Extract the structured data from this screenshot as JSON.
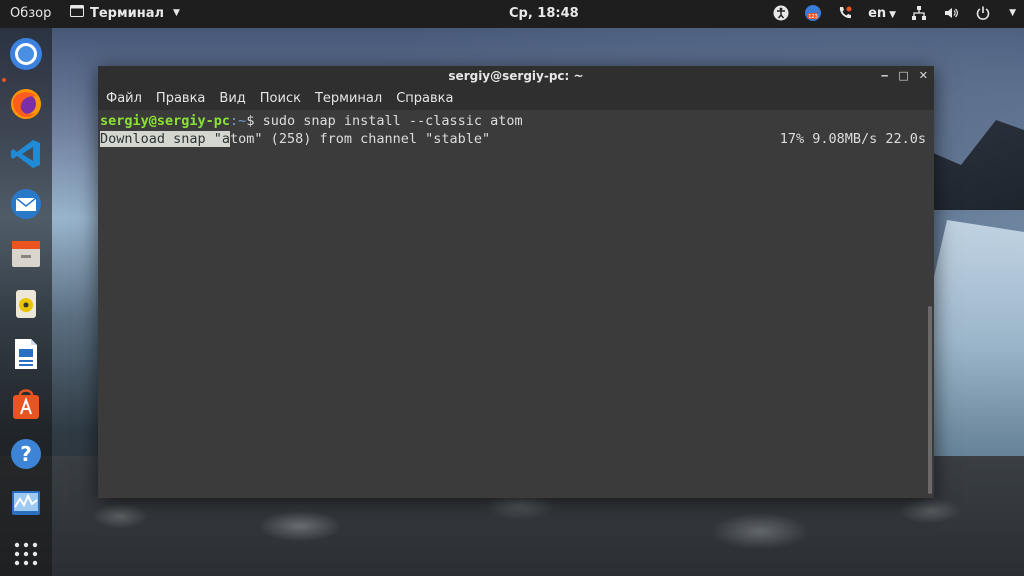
{
  "topbar": {
    "activities": "Обзор",
    "app_menu": "Терминал",
    "clock": "Ср, 18:48",
    "lang": "en",
    "icons": [
      "accessibility-icon",
      "calendar-badge-icon",
      "phone-icon",
      "network-icon",
      "volume-icon",
      "power-icon"
    ]
  },
  "dock": {
    "items": [
      "chromium-icon",
      "firefox-icon",
      "vscode-icon",
      "mail-icon",
      "files-icon",
      "music-icon",
      "writer-icon",
      "software-center-icon",
      "help-icon",
      "system-monitor-icon",
      "app-grid-icon"
    ]
  },
  "window": {
    "title": "sergiy@sergiy-pc: ~",
    "menu": [
      "Файл",
      "Правка",
      "Вид",
      "Поиск",
      "Терминал",
      "Справка"
    ],
    "terminal": {
      "prompt_user": "sergiy@sergiy-pc",
      "prompt_path": ":~",
      "prompt_symbol": "$ ",
      "command": "sudo snap install --classic atom",
      "output_selected": "Download snap \"a",
      "output_rest": "tom\" (258) from channel \"stable\"",
      "progress": "17% 9.08MB/s 22.0s"
    }
  },
  "colors": {
    "prompt_user": "#8ae234",
    "prompt_path": "#729fcf",
    "terminal_bg": "#3b3b3b",
    "accent": "#e95420"
  }
}
